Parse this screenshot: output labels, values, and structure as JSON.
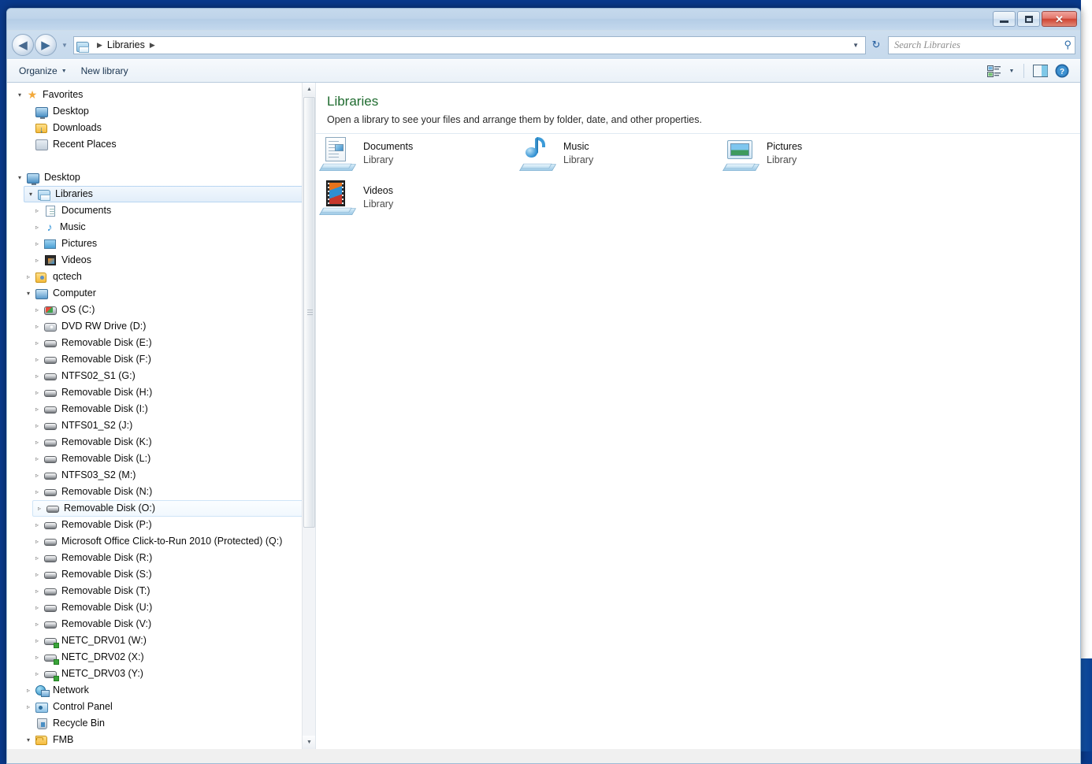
{
  "window": {
    "controls": {
      "minimize_label": "Minimize",
      "maximize_label": "Maximize",
      "close_label": "Close",
      "close_glyph": "✕"
    }
  },
  "navbar": {
    "back_label": "Back",
    "back_glyph": "◀",
    "forward_label": "Forward",
    "forward_glyph": "▶",
    "history_glyph": "▼",
    "address_icon": "libraries-icon",
    "breadcrumb": [
      "Libraries"
    ],
    "crumb_sep_glyph": "▶",
    "address_dropdown_glyph": "▼",
    "refresh_glyph": "↻",
    "refresh_label": "Refresh"
  },
  "search": {
    "placeholder": "Search Libraries",
    "value": "",
    "icon": "search-icon",
    "icon_glyph": "⚲"
  },
  "toolbar": {
    "organize_label": "Organize",
    "organize_caret": "▼",
    "new_library_label": "New library",
    "view_icon": "view-options-icon",
    "view_caret": "▼",
    "preview_pane_icon": "preview-pane-icon",
    "help_icon": "help-icon",
    "help_glyph": "?"
  },
  "sidebar": {
    "scrollbar": {
      "up_glyph": "▲",
      "down_glyph": "▼"
    },
    "nodes": [
      {
        "label": "Favorites",
        "icon": "star-icon",
        "indent": 0,
        "state": "expanded",
        "icon_class": "ic-star"
      },
      {
        "label": "Desktop",
        "icon": "monitor-icon",
        "indent": 1,
        "state": "leaf",
        "icon_class": "ic-monitor"
      },
      {
        "label": "Downloads",
        "icon": "downloads-icon",
        "indent": 1,
        "state": "leaf",
        "icon_class": "ic-dl"
      },
      {
        "label": "Recent Places",
        "icon": "recent-icon",
        "indent": 1,
        "state": "leaf",
        "icon_class": "ic-recent"
      },
      {
        "label": "",
        "icon": "spacer",
        "indent": 0,
        "state": "spacer",
        "icon_class": ""
      },
      {
        "label": "Desktop",
        "icon": "monitor-icon",
        "indent": 0,
        "state": "expanded",
        "icon_class": "ic-monitor"
      },
      {
        "label": "Libraries",
        "icon": "libraries-icon",
        "indent": 1,
        "state": "expanded",
        "icon_class": "ic-lib",
        "selected": true
      },
      {
        "label": "Documents",
        "icon": "document-icon",
        "indent": 2,
        "state": "collapsed",
        "icon_class": "ic-doc"
      },
      {
        "label": "Music",
        "icon": "music-icon",
        "indent": 2,
        "state": "collapsed",
        "icon_class": "ic-music"
      },
      {
        "label": "Pictures",
        "icon": "picture-icon",
        "indent": 2,
        "state": "collapsed",
        "icon_class": "ic-pic"
      },
      {
        "label": "Videos",
        "icon": "video-icon",
        "indent": 2,
        "state": "collapsed",
        "icon_class": "ic-vid"
      },
      {
        "label": "qctech",
        "icon": "user-folder-icon",
        "indent": 1,
        "state": "collapsed",
        "icon_class": "ic-user"
      },
      {
        "label": "Computer",
        "icon": "computer-icon",
        "indent": 1,
        "state": "expanded",
        "icon_class": "ic-computer"
      },
      {
        "label": "OS (C:)",
        "icon": "hard-drive-icon",
        "indent": 2,
        "state": "collapsed",
        "icon_class": "ic-hdd-os"
      },
      {
        "label": "DVD RW Drive (D:)",
        "icon": "dvd-drive-icon",
        "indent": 2,
        "state": "collapsed",
        "icon_class": "ic-dvd"
      },
      {
        "label": "Removable Disk (E:)",
        "icon": "removable-disk-icon",
        "indent": 2,
        "state": "collapsed",
        "icon_class": "ic-hdd"
      },
      {
        "label": "Removable Disk (F:)",
        "icon": "removable-disk-icon",
        "indent": 2,
        "state": "collapsed",
        "icon_class": "ic-hdd"
      },
      {
        "label": "NTFS02_S1 (G:)",
        "icon": "removable-disk-icon",
        "indent": 2,
        "state": "collapsed",
        "icon_class": "ic-hdd"
      },
      {
        "label": "Removable Disk (H:)",
        "icon": "removable-disk-icon",
        "indent": 2,
        "state": "collapsed",
        "icon_class": "ic-hdd"
      },
      {
        "label": "Removable Disk (I:)",
        "icon": "removable-disk-icon",
        "indent": 2,
        "state": "collapsed",
        "icon_class": "ic-hdd"
      },
      {
        "label": "NTFS01_S2 (J:)",
        "icon": "removable-disk-icon",
        "indent": 2,
        "state": "collapsed",
        "icon_class": "ic-hdd"
      },
      {
        "label": "Removable Disk (K:)",
        "icon": "removable-disk-icon",
        "indent": 2,
        "state": "collapsed",
        "icon_class": "ic-hdd"
      },
      {
        "label": "Removable Disk (L:)",
        "icon": "removable-disk-icon",
        "indent": 2,
        "state": "collapsed",
        "icon_class": "ic-hdd"
      },
      {
        "label": "NTFS03_S2 (M:)",
        "icon": "removable-disk-icon",
        "indent": 2,
        "state": "collapsed",
        "icon_class": "ic-hdd"
      },
      {
        "label": "Removable Disk (N:)",
        "icon": "removable-disk-icon",
        "indent": 2,
        "state": "collapsed",
        "icon_class": "ic-hdd"
      },
      {
        "label": "Removable Disk (O:)",
        "icon": "removable-disk-icon",
        "indent": 2,
        "state": "collapsed",
        "icon_class": "ic-hdd",
        "hovered": true
      },
      {
        "label": "Removable Disk (P:)",
        "icon": "removable-disk-icon",
        "indent": 2,
        "state": "collapsed",
        "icon_class": "ic-hdd"
      },
      {
        "label": "Microsoft Office Click-to-Run 2010 (Protected) (Q:)",
        "icon": "removable-disk-icon",
        "indent": 2,
        "state": "collapsed",
        "icon_class": "ic-hdd"
      },
      {
        "label": "Removable Disk (R:)",
        "icon": "removable-disk-icon",
        "indent": 2,
        "state": "collapsed",
        "icon_class": "ic-hdd"
      },
      {
        "label": "Removable Disk (S:)",
        "icon": "removable-disk-icon",
        "indent": 2,
        "state": "collapsed",
        "icon_class": "ic-hdd"
      },
      {
        "label": "Removable Disk (T:)",
        "icon": "removable-disk-icon",
        "indent": 2,
        "state": "collapsed",
        "icon_class": "ic-hdd"
      },
      {
        "label": "Removable Disk (U:)",
        "icon": "removable-disk-icon",
        "indent": 2,
        "state": "collapsed",
        "icon_class": "ic-hdd"
      },
      {
        "label": "Removable Disk (V:)",
        "icon": "removable-disk-icon",
        "indent": 2,
        "state": "collapsed",
        "icon_class": "ic-hdd"
      },
      {
        "label": "NETC_DRV01 (W:)",
        "icon": "network-drive-icon",
        "indent": 2,
        "state": "collapsed",
        "icon_class": "ic-net-drv"
      },
      {
        "label": "NETC_DRV02 (X:)",
        "icon": "network-drive-icon",
        "indent": 2,
        "state": "collapsed",
        "icon_class": "ic-net-drv"
      },
      {
        "label": "NETC_DRV03 (Y:)",
        "icon": "network-drive-icon",
        "indent": 2,
        "state": "collapsed",
        "icon_class": "ic-net-drv"
      },
      {
        "label": "Network",
        "icon": "network-icon",
        "indent": 1,
        "state": "collapsed",
        "icon_class": "ic-network"
      },
      {
        "label": "Control Panel",
        "icon": "control-panel-icon",
        "indent": 1,
        "state": "collapsed",
        "icon_class": "ic-cpanel"
      },
      {
        "label": "Recycle Bin",
        "icon": "recycle-bin-icon",
        "indent": 1,
        "state": "leaf",
        "icon_class": "ic-bin"
      },
      {
        "label": "FMB",
        "icon": "folder-icon",
        "indent": 1,
        "state": "expanded",
        "icon_class": "ic-folder"
      }
    ],
    "expander_collapsed_glyph": "▹",
    "expander_expanded_glyph": "▾"
  },
  "content": {
    "heading": "Libraries",
    "description": "Open a library to see your files and arrange them by folder, date, and other properties.",
    "tiles": [
      {
        "name": "Documents",
        "sub": "Library",
        "icon": "documents-library-icon"
      },
      {
        "name": "Music",
        "sub": "Library",
        "icon": "music-library-icon"
      },
      {
        "name": "Pictures",
        "sub": "Library",
        "icon": "pictures-library-icon"
      },
      {
        "name": "Videos",
        "sub": "Library",
        "icon": "videos-library-icon"
      }
    ]
  },
  "colors": {
    "desktop": "#0a3a8c",
    "heading_green": "#1f6b2f",
    "selection_blue": "#b9d6f2",
    "close_red": "#cf4433"
  }
}
